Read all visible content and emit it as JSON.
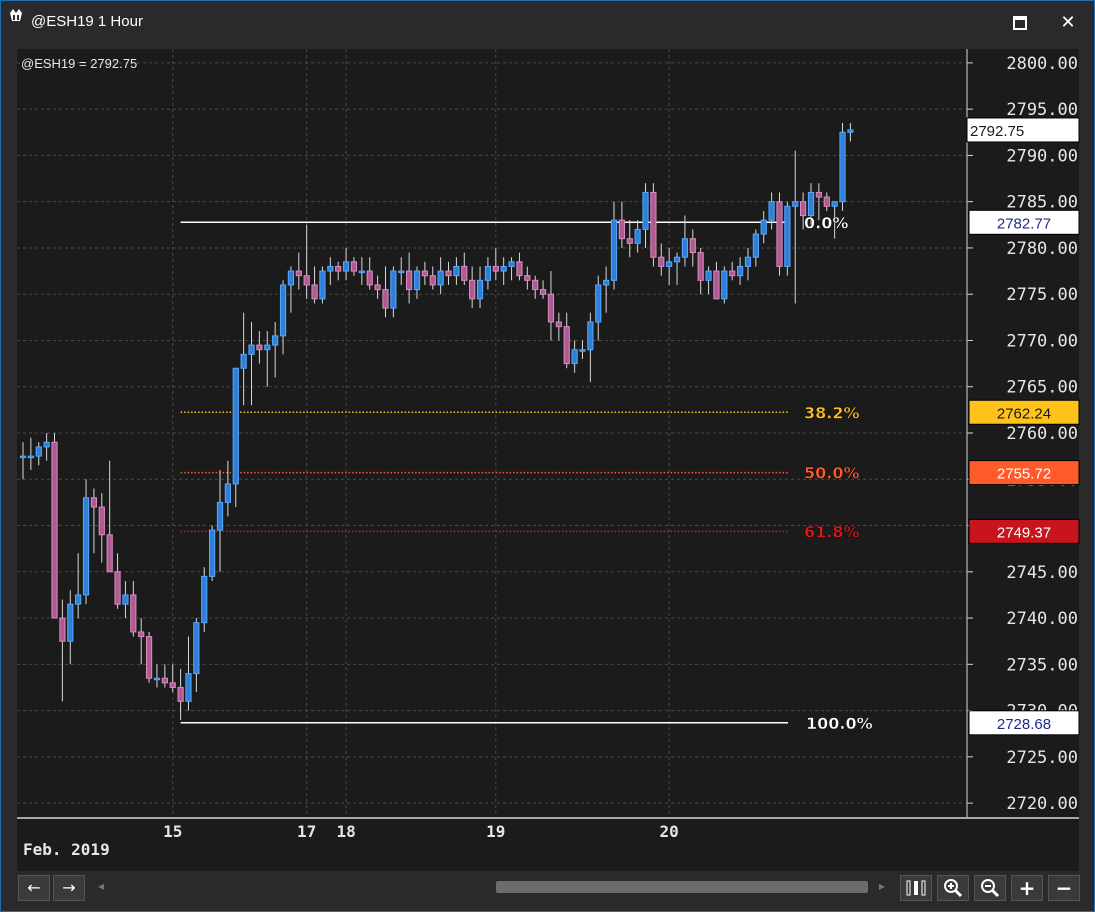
{
  "window": {
    "title": "@ESH19 1 Hour",
    "maximize_symbol": "□",
    "close_symbol": "✕"
  },
  "chart_data": {
    "type": "candlestick",
    "symbol_label": "@ESH19 = 2792.75",
    "ylim": [
      2718.5,
      2801.5
    ],
    "y_ticks": [
      2720,
      2725,
      2730,
      2735,
      2740,
      2745,
      2750,
      2755,
      2760,
      2765,
      2770,
      2775,
      2780,
      2785,
      2790,
      2795,
      2800
    ],
    "y_tick_format": "0.00",
    "x_tick_labels": [
      {
        "label": "15",
        "bar": 19
      },
      {
        "label": "17",
        "bar": 36
      },
      {
        "label": "18",
        "bar": 41
      },
      {
        "label": "19",
        "bar": 60
      },
      {
        "label": "20",
        "bar": 82
      }
    ],
    "x_sublabel": "Feb. 2019",
    "grid": true,
    "colors": {
      "up_body": "#2f7fd6",
      "up_edge": "#56a8ff",
      "down_body": "#b05a92",
      "down_edge": "#d98cc0",
      "wick": "#d8d8d8",
      "background": "#1b1b1b",
      "grid": "#4a4a4a",
      "axis_text": "#e6e6e6"
    },
    "last_price": {
      "value": 2792.75,
      "label": "2792.75"
    },
    "fibonacci": [
      {
        "level": "0.0%",
        "price": 2782.77,
        "label": "2782.77",
        "color": "#ffffff",
        "style": "solid",
        "box_bg": "#ffffff",
        "box_text": "#1f2a8a",
        "line_start_bar": 20
      },
      {
        "level": "38.2%",
        "price": 2762.24,
        "label": "2762.24",
        "color": "#ffc21a",
        "style": "dotted",
        "box_bg": "#ffc21a",
        "box_text": "#1a1a1a",
        "line_start_bar": 20
      },
      {
        "level": "50.0%",
        "price": 2755.72,
        "label": "2755.72",
        "color": "#ff5a2a",
        "style": "dotted",
        "box_bg": "#ff5a2a",
        "box_text": "#ffffff",
        "line_start_bar": 20
      },
      {
        "level": "61.8%",
        "price": 2749.37,
        "label": "2749.37",
        "color": "#dd1a1a",
        "style": "dotted",
        "box_bg": "#c8141c",
        "box_text": "#ffffff",
        "line_start_bar": 20
      },
      {
        "level": "100.0%",
        "price": 2728.68,
        "label": "2728.68",
        "color": "#ffffff",
        "style": "solid",
        "box_bg": "#ffffff",
        "box_text": "#1f2a8a",
        "line_start_bar": 20
      }
    ],
    "bars": [
      [
        2757.5,
        2759,
        2755,
        2757.5
      ],
      [
        2757.5,
        2759.5,
        2756,
        2757.5
      ],
      [
        2757.5,
        2759,
        2756.5,
        2758.5
      ],
      [
        2758.5,
        2760,
        2757,
        2759
      ],
      [
        2759,
        2760,
        2741,
        2740
      ],
      [
        2740,
        2742,
        2731,
        2737.5
      ],
      [
        2737.5,
        2743,
        2735,
        2741.5
      ],
      [
        2741.5,
        2747,
        2740,
        2742.5
      ],
      [
        2742.5,
        2755,
        2741.5,
        2753
      ],
      [
        2753,
        2754,
        2747,
        2752
      ],
      [
        2752,
        2753.5,
        2746,
        2749
      ],
      [
        2749,
        2757,
        2745,
        2745
      ],
      [
        2745,
        2747,
        2741,
        2741.5
      ],
      [
        2741.5,
        2744,
        2740,
        2742.5
      ],
      [
        2742.5,
        2744,
        2738,
        2738.5
      ],
      [
        2738.5,
        2740,
        2735,
        2738
      ],
      [
        2738,
        2738.5,
        2733,
        2733.5
      ],
      [
        2733.5,
        2735,
        2732.5,
        2733.5
      ],
      [
        2733.5,
        2735,
        2732.5,
        2733
      ],
      [
        2733,
        2735,
        2732,
        2732.5
      ],
      [
        2732.5,
        2734.5,
        2729,
        2731
      ],
      [
        2731,
        2738,
        2730,
        2734
      ],
      [
        2734,
        2740,
        2732,
        2739.5
      ],
      [
        2739.5,
        2745.5,
        2738.5,
        2744.5
      ],
      [
        2744.5,
        2750,
        2744,
        2749.5
      ],
      [
        2749.5,
        2756,
        2745,
        2752.5
      ],
      [
        2752.5,
        2757,
        2751,
        2754.5
      ],
      [
        2754.5,
        2767,
        2752,
        2767
      ],
      [
        2767,
        2773,
        2763,
        2768.5
      ],
      [
        2768.5,
        2772,
        2763,
        2769.5
      ],
      [
        2769.5,
        2771,
        2767.5,
        2769
      ],
      [
        2769,
        2771,
        2765,
        2769.5
      ],
      [
        2769.5,
        2772,
        2766,
        2770.5
      ],
      [
        2770.5,
        2776.5,
        2768.5,
        2776
      ],
      [
        2776,
        2778,
        2773,
        2777.5
      ],
      [
        2777.5,
        2779.5,
        2775.5,
        2777
      ],
      [
        2777,
        2782.5,
        2774.5,
        2776
      ],
      [
        2776,
        2778,
        2774,
        2774.5
      ],
      [
        2774.5,
        2778,
        2774,
        2777.5
      ],
      [
        2777.5,
        2779,
        2776,
        2778
      ],
      [
        2778,
        2778.5,
        2776.5,
        2777.5
      ],
      [
        2777.5,
        2780,
        2776.5,
        2778.5
      ],
      [
        2778.5,
        2779,
        2777,
        2777.5
      ],
      [
        2777.5,
        2779,
        2776,
        2777.5
      ],
      [
        2777.5,
        2779,
        2775.5,
        2776
      ],
      [
        2776,
        2777,
        2774.5,
        2775.5
      ],
      [
        2775.5,
        2778,
        2772.5,
        2773.5
      ],
      [
        2773.5,
        2778,
        2772.5,
        2777.5
      ],
      [
        2777.5,
        2779,
        2776,
        2777.5
      ],
      [
        2777.5,
        2779.5,
        2774,
        2775.5
      ],
      [
        2775.5,
        2778,
        2774.5,
        2777.5
      ],
      [
        2777.5,
        2778.5,
        2776,
        2777
      ],
      [
        2777,
        2778,
        2775.5,
        2776
      ],
      [
        2776,
        2779,
        2775,
        2777.5
      ],
      [
        2777.5,
        2778.5,
        2776,
        2777
      ],
      [
        2777,
        2779,
        2776,
        2778
      ],
      [
        2778,
        2779.5,
        2776,
        2776.5
      ],
      [
        2776.5,
        2778,
        2773.5,
        2774.5
      ],
      [
        2774.5,
        2778,
        2773.5,
        2776.5
      ],
      [
        2776.5,
        2779,
        2775.5,
        2778
      ],
      [
        2778,
        2780,
        2776.5,
        2777.5
      ],
      [
        2777.5,
        2779,
        2776,
        2778
      ],
      [
        2778,
        2779,
        2776.5,
        2778.5
      ],
      [
        2778.5,
        2779.5,
        2776.5,
        2777
      ],
      [
        2777,
        2778,
        2775.5,
        2776.5
      ],
      [
        2776.5,
        2777,
        2774.5,
        2775.5
      ],
      [
        2775.5,
        2776.5,
        2774.5,
        2775
      ],
      [
        2775,
        2777.5,
        2770,
        2772
      ],
      [
        2772,
        2773,
        2770,
        2771.5
      ],
      [
        2771.5,
        2773,
        2767,
        2767.5
      ],
      [
        2767.5,
        2770,
        2766.5,
        2769
      ],
      [
        2769,
        2770,
        2768,
        2769
      ],
      [
        2769,
        2773,
        2765.5,
        2772
      ],
      [
        2772,
        2777,
        2770,
        2776
      ],
      [
        2776,
        2778,
        2773,
        2776.5
      ],
      [
        2776.5,
        2785,
        2775.5,
        2783
      ],
      [
        2783,
        2785,
        2780,
        2781
      ],
      [
        2781,
        2783,
        2779,
        2780.5
      ],
      [
        2780.5,
        2783,
        2779.5,
        2782
      ],
      [
        2782,
        2787,
        2780,
        2786
      ],
      [
        2786,
        2787,
        2778,
        2779
      ],
      [
        2779,
        2780.5,
        2777,
        2778
      ],
      [
        2778,
        2780,
        2776,
        2778.5
      ],
      [
        2778.5,
        2779.5,
        2776,
        2779
      ],
      [
        2779,
        2783.5,
        2778,
        2781
      ],
      [
        2781,
        2782,
        2778,
        2779.5
      ],
      [
        2779.5,
        2780,
        2775,
        2776.5
      ],
      [
        2776.5,
        2778,
        2775,
        2777.5
      ],
      [
        2777.5,
        2778.5,
        2774.5,
        2774.5
      ],
      [
        2774.5,
        2778,
        2774,
        2777.5
      ],
      [
        2777.5,
        2778.5,
        2776.5,
        2777
      ],
      [
        2777,
        2779,
        2776,
        2778
      ],
      [
        2778,
        2780,
        2776.5,
        2779
      ],
      [
        2779,
        2782,
        2778,
        2781.5
      ],
      [
        2781.5,
        2784,
        2780.5,
        2783
      ],
      [
        2783,
        2786,
        2782,
        2785
      ],
      [
        2785,
        2786,
        2777,
        2778
      ],
      [
        2778,
        2785,
        2777,
        2784.5
      ],
      [
        2784.5,
        2790.5,
        2774,
        2785
      ],
      [
        2785,
        2786,
        2782,
        2783.5
      ],
      [
        2783.5,
        2787,
        2782.5,
        2786
      ],
      [
        2786,
        2787,
        2783,
        2785.5
      ],
      [
        2785.5,
        2786,
        2784,
        2784.5
      ],
      [
        2784.5,
        2785,
        2781,
        2785
      ],
      [
        2785,
        2793.5,
        2784,
        2792.5
      ],
      [
        2792.5,
        2793.5,
        2791.5,
        2792.75
      ]
    ]
  },
  "toolbar": {
    "back_symbol": "←",
    "forward_symbol": "→",
    "plus_symbol": "+",
    "minus_symbol": "−"
  }
}
